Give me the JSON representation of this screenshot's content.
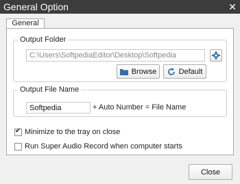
{
  "window": {
    "title": "General Option",
    "close_glyph": "✕"
  },
  "tabs": [
    {
      "label": "General"
    }
  ],
  "output_folder": {
    "legend": "Output Folder",
    "path_value": "C:\\Users\\SoftpediaEditor\\Desktop\\Softpedia",
    "settings_icon": "gear-icon",
    "browse_label": "Browse",
    "browse_icon": "folder-icon",
    "default_label": "Default",
    "default_icon": "refresh-icon"
  },
  "output_file_name": {
    "legend": "Output File Name",
    "name_value": "Softpedia",
    "suffix_text": "+ Auto Number = File Name"
  },
  "options": [
    {
      "label": "Minimize to the tray on close",
      "checked": true
    },
    {
      "label": "Run Super Audio Record when computer starts",
      "checked": false
    }
  ],
  "footer": {
    "close_label": "Close"
  },
  "colors": {
    "titlebar": "#3c3c3c",
    "accent_icon": "#2f6fb3"
  }
}
